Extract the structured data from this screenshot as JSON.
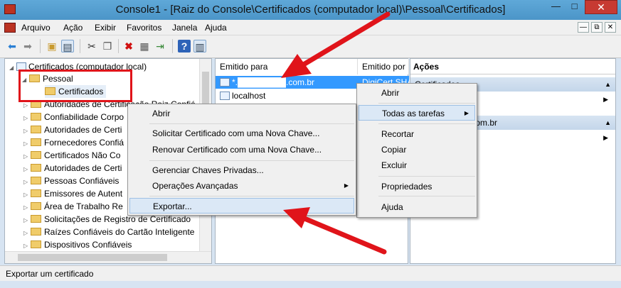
{
  "window": {
    "title": "Console1 - [Raiz do Console\\Certificados (computador local)\\Pessoal\\Certificados]",
    "min": "—",
    "max": "□",
    "close": "✕"
  },
  "menu": [
    "Arquivo",
    "Ação",
    "Exibir",
    "Favoritos",
    "Janela",
    "Ajuda"
  ],
  "mdi": {
    "min": "—",
    "restore": "⧉",
    "close": "✕"
  },
  "toolbar": {
    "icons": [
      "back-icon",
      "forward-icon",
      "up-folder-icon",
      "show-hide-tree-icon",
      "cut-icon",
      "copy-icon",
      "delete-icon",
      "properties-icon",
      "export-list-icon",
      "help-icon",
      "show-hide-action-pane-icon"
    ]
  },
  "tree": {
    "root": "Certificados (computador local)",
    "items": [
      "Pessoal",
      "Certificados",
      "Autoridades de Certificação Raiz Confiá",
      "Confiabilidade Corpo",
      "Autoridades de Certi",
      "Fornecedores Confiá",
      "Certificados Não Co",
      "Autoridades de Certi",
      "Pessoas Confiáveis",
      "Emissores de Autent",
      "Área de Trabalho Re",
      "Solicitações de Registro de Certificado",
      "Raízes Confiáveis do Cartão Inteligente",
      "Dispositivos Confiáveis"
    ]
  },
  "list": {
    "col1": "Emitido para",
    "col2": "Emitido por",
    "rows": [
      {
        "name": "*.████████.com.br",
        "issuer": "DigiCert SHA"
      },
      {
        "name": "localhost",
        "issuer": ""
      }
    ]
  },
  "actions": {
    "header": "Ações",
    "band1": "Certificados",
    "band2": "*.████████.com.br"
  },
  "context_main": {
    "items": [
      "Abrir",
      "Solicitar Certificado com uma Nova Chave...",
      "Renovar Certificado com uma Nova Chave...",
      "Gerenciar Chaves Privadas...",
      "Operações Avançadas",
      "Exportar..."
    ]
  },
  "context_top": {
    "items": [
      "Abrir",
      "Todas as tarefas",
      "Recortar",
      "Copiar",
      "Excluir",
      "Propriedades",
      "Ajuda"
    ]
  },
  "status": "Exportar um certificado",
  "colors": {
    "highlight": "#dbe8f6",
    "annotation_red": "#e0141a",
    "title_blue": "#5fa8d8"
  }
}
